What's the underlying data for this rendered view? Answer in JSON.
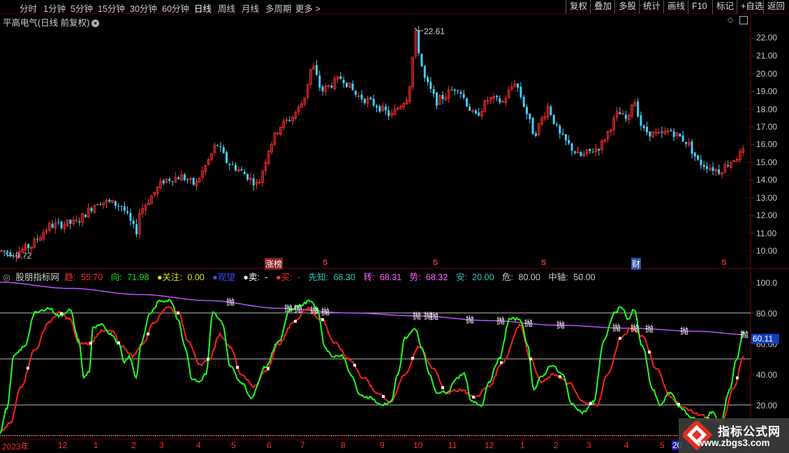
{
  "toolbar": {
    "periods": [
      "分时",
      "1分钟",
      "5分钟",
      "15分钟",
      "30分钟",
      "60分钟",
      "日线",
      "周线",
      "月线",
      "多周期",
      "更多"
    ],
    "active_period": "日线",
    "more_arrow": ">",
    "right_buttons": [
      "复权",
      "叠加",
      "多股",
      "统计",
      "画线",
      "F10",
      "标记",
      "+自选",
      "返回"
    ]
  },
  "price_panel": {
    "title": "平高电气(日线 前复权)",
    "high_label": "22.61",
    "low_label": "9.72",
    "y_axis": [
      "22.00",
      "21.00",
      "20.00",
      "19.00",
      "18.00",
      "17.00",
      "16.00",
      "15.00",
      "14.00",
      "13.00",
      "12.00",
      "11.00",
      "10.00"
    ],
    "badges": [
      "涨榜",
      "财"
    ],
    "s_marker": "S"
  },
  "indicator_panel": {
    "name": "股朋指标网",
    "legend": [
      {
        "label": "趋:",
        "value": "55.70",
        "color": "#ff3030"
      },
      {
        "label": "向:",
        "value": "71.98",
        "color": "#20e020"
      },
      {
        "label": "●关注:",
        "value": "0.00",
        "color": "#e0e020"
      },
      {
        "label": "●观望",
        "value": "",
        "color": "#4050ff"
      },
      {
        "label": "●卖:",
        "value": "-",
        "color": "#ffffff"
      },
      {
        "label": "●买:",
        "value": "-",
        "color": "#ff3030"
      },
      {
        "label": "先知:",
        "value": "68.30",
        "color": "#30c0c0"
      },
      {
        "label": "转:",
        "value": "68.31",
        "color": "#ff60ff"
      },
      {
        "label": "势:",
        "value": "68.32",
        "color": "#ff60ff"
      },
      {
        "label": "安:",
        "value": "20.00",
        "color": "#30c0c0"
      },
      {
        "label": "危:",
        "value": "80.00",
        "color": "#c8c8c8"
      },
      {
        "label": "中轴:",
        "value": "50.00",
        "color": "#c8c8c8"
      }
    ],
    "y_axis": [
      "100.0",
      "80.00",
      "60.00",
      "40.00",
      "20.00"
    ],
    "current_value": "60.11",
    "throw_label": "抛"
  },
  "date_axis": [
    "2023年",
    "12",
    "1",
    "2",
    "3",
    "4",
    "5",
    "6",
    "7",
    "8",
    "9",
    "10",
    "11",
    "12",
    "1",
    "2",
    "3",
    "4",
    "5",
    "20"
  ],
  "watermark": {
    "title": "指标公式网",
    "url": "www.zbgs3.com"
  },
  "colors": {
    "up": "#ff3030",
    "down": "#40d0ff",
    "trend": "#ff2020",
    "direction": "#20ff20",
    "purple": "#c050ff",
    "grid": "#7a0000"
  }
}
